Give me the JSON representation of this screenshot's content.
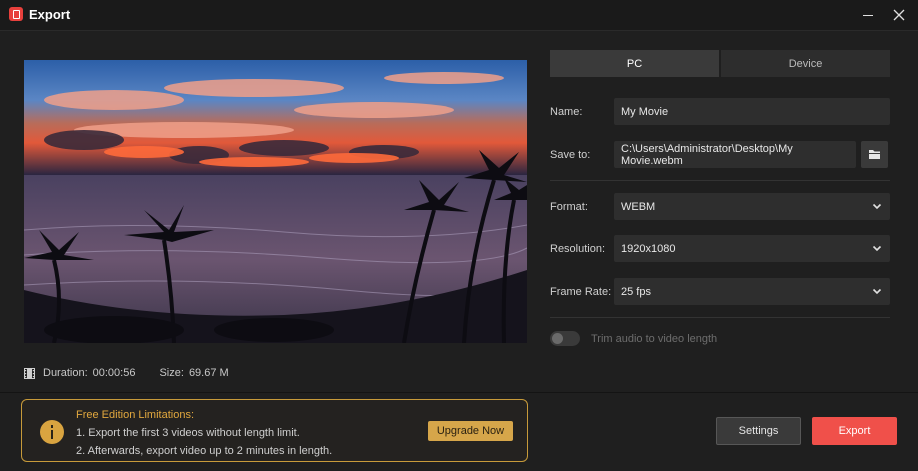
{
  "window": {
    "title": "Export",
    "icons": {
      "app": "app-logo-icon",
      "minimize": "minimize-icon",
      "close": "close-icon"
    }
  },
  "preview": {
    "duration_label": "Duration:",
    "duration": "00:00:56",
    "size_label": "Size:",
    "size": "69.67 M",
    "icon": "film-icon"
  },
  "tabs": [
    {
      "label": "PC",
      "active": true
    },
    {
      "label": "Device",
      "active": false
    }
  ],
  "form": {
    "name_label": "Name:",
    "name_value": "My Movie",
    "save_to_label": "Save to:",
    "save_to_value": "C:\\Users\\Administrator\\Desktop\\My Movie.webm",
    "format_label": "Format:",
    "format_value": "WEBM",
    "resolution_label": "Resolution:",
    "resolution_value": "1920x1080",
    "frame_rate_label": "Frame Rate:",
    "frame_rate_value": "25 fps",
    "trim_label": "Trim audio to video length",
    "trim_enabled": false
  },
  "limitations": {
    "title": "Free Edition Limitations:",
    "line1": "1. Export the first 3 videos without length limit.",
    "line2": "2. Afterwards, export video up to 2 minutes in length.",
    "upgrade_label": "Upgrade Now",
    "icon": "warning-icon"
  },
  "actions": {
    "settings_label": "Settings",
    "export_label": "Export"
  },
  "colors": {
    "accent_export": "#f0504a",
    "warning": "#d6a64a",
    "background": "#1f1f1f"
  }
}
